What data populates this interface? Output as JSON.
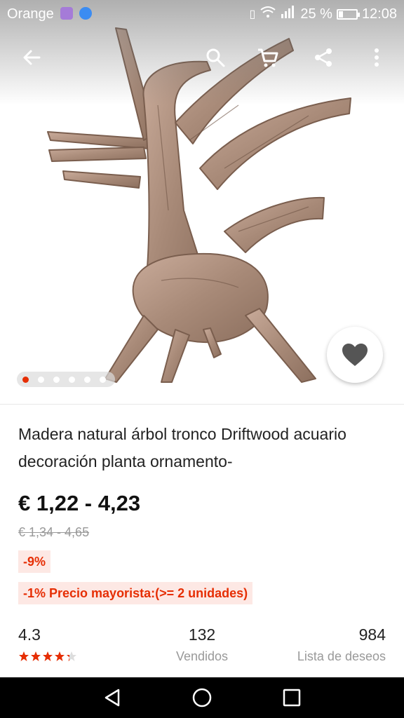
{
  "status_bar": {
    "carrier": "Orange",
    "battery_text": "25 %",
    "battery_level": 0.25,
    "time": "12:08"
  },
  "toolbar": {
    "icons": [
      "back-arrow-icon",
      "search-icon",
      "cart-icon",
      "share-icon",
      "more-vert-icon"
    ]
  },
  "gallery": {
    "image_count": 6,
    "active_index": 0
  },
  "product": {
    "title": "Madera natural árbol tronco Driftwood acuario decoración planta ornamento-",
    "price": "€ 1,22 - 4,23",
    "original_price": "€ 1,34 - 4,65",
    "discount_badge": "-9%",
    "wholesale_badge": "-1% Precio mayorista:(>= 2 unidades)"
  },
  "stats": {
    "rating_value": "4.3",
    "rating_stars": 4.3,
    "sold_count": "132",
    "sold_label": "Vendidos",
    "wishlist_count": "984",
    "wishlist_label": "Lista de deseos"
  },
  "colors": {
    "accent": "#e62e04",
    "badge_bg": "#fde8e4",
    "star": "#e62e04"
  }
}
